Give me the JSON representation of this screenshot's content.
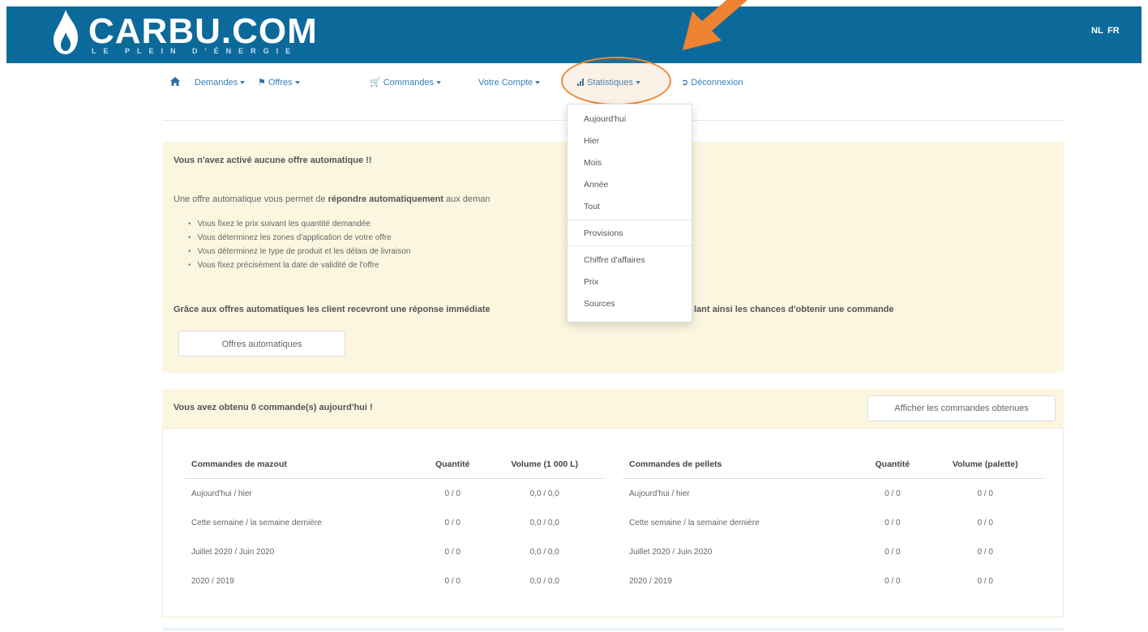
{
  "header": {
    "brand": "CARBU.COM",
    "tagline": "LE PLEIN D'ÉNERGIE",
    "lang_nl": "NL",
    "lang_fr": "FR",
    "bar_color": "#0c6a9a"
  },
  "nav": {
    "home_icon": "home-icon",
    "items": [
      {
        "label": "Demandes",
        "icon": ""
      },
      {
        "label": "Offres",
        "icon": "tag-icon"
      },
      {
        "label": "Commandes",
        "icon": "cart-icon"
      },
      {
        "label": "Votre Compte",
        "icon": ""
      },
      {
        "label": "Statistiques",
        "icon": "bar-chart-icon"
      },
      {
        "label": "Déconnexion",
        "icon": "logout-icon"
      }
    ]
  },
  "dropdown": {
    "items": [
      "Aujourd'hui",
      "Hier",
      "Mois",
      "Année",
      "Tout",
      "Provisions",
      "Chiffre d'affaires",
      "Prix",
      "Sources"
    ]
  },
  "annotation": {
    "highlight_color": "#e98a3a"
  },
  "warning": {
    "title": "Vous n'avez activé aucune offre automatique !!",
    "intro_prefix": "Une offre automatique vous permet de ",
    "intro_bold": "répondre automatiquement",
    "intro_suffix": " aux deman",
    "bullets": [
      "Vous fixez le prix suivant les quantité demandée",
      "Vous déterminez les zones d'application de votre offre",
      "Vous déterminez le type de produit et les délais de livraison",
      "Vous fixez précisément la date de validité de l'offre"
    ],
    "grace_left": "Grâce aux offres automatiques les client recevront une réponse immédiate",
    "grace_right": "lant ainsi les chances d'obtenir une commande",
    "button": "Offres automatiques"
  },
  "orders": {
    "title": "Vous avez obtenu 0 commande(s) aujourd'hui !",
    "show_button": "Afficher les commandes obtenues",
    "mazout": {
      "headers": [
        "Commandes de mazout",
        "Quantité",
        "Volume (1 000 L)"
      ],
      "rows": [
        [
          "Aujourd'hui / hier",
          "0 / 0",
          "0,0 / 0,0"
        ],
        [
          "Cette semaine / la semaine dernière",
          "0 / 0",
          "0,0 / 0,0"
        ],
        [
          "Juillet 2020 / Juin 2020",
          "0 / 0",
          "0,0 / 0,0"
        ],
        [
          "2020 / 2019",
          "0 / 0",
          "0,0 / 0,0"
        ]
      ]
    },
    "pellets": {
      "headers": [
        "Commandes de pellets",
        "Quantité",
        "Volume (palette)"
      ],
      "rows": [
        [
          "Aujourd'hui / hier",
          "0 / 0",
          "0 / 0"
        ],
        [
          "Cette semaine / la semaine dernière",
          "0 / 0",
          "0 / 0"
        ],
        [
          "Juillet 2020 / Juin 2020",
          "0 / 0",
          "0 / 0"
        ],
        [
          "2020 / 2019",
          "0 / 0",
          "0 / 0"
        ]
      ]
    }
  }
}
